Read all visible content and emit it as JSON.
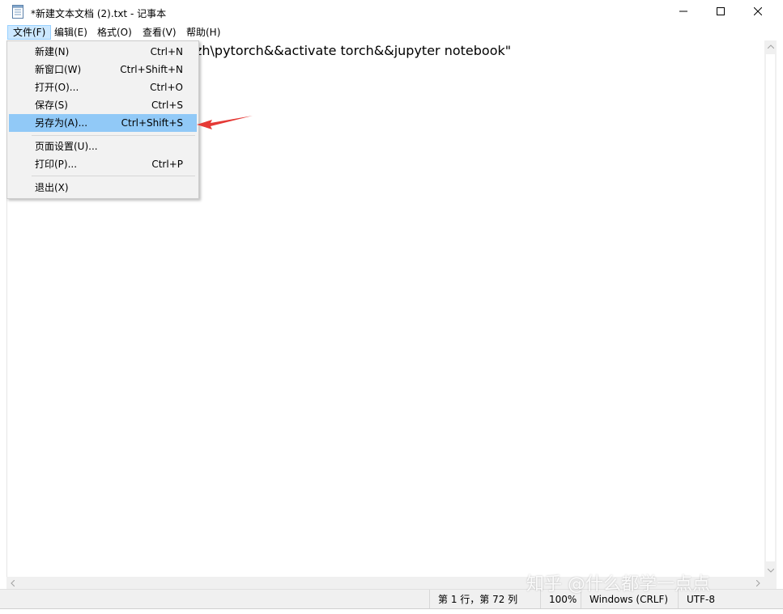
{
  "window": {
    "title": "*新建文本文档 (2).txt - 记事本"
  },
  "menubar": {
    "items": [
      "文件(F)",
      "编辑(E)",
      "格式(O)",
      "查看(V)",
      "帮助(H)"
    ]
  },
  "file_menu": {
    "items": [
      {
        "label": "新建(N)",
        "shortcut": "Ctrl+N"
      },
      {
        "label": "新窗口(W)",
        "shortcut": "Ctrl+Shift+N"
      },
      {
        "label": "打开(O)...",
        "shortcut": "Ctrl+O"
      },
      {
        "label": "保存(S)",
        "shortcut": "Ctrl+S"
      },
      {
        "label": "另存为(A)...",
        "shortcut": "Ctrl+Shift+S",
        "highlighted": true
      },
      {
        "label": "页面设置(U)...",
        "shortcut": ""
      },
      {
        "label": "打印(P)...",
        "shortcut": "Ctrl+P"
      },
      {
        "label": "退出(X)",
        "shortcut": ""
      }
    ]
  },
  "editor": {
    "text": "zh\\pytorch&&activate torch&&jupyter notebook\""
  },
  "statusbar": {
    "position": "第 1 行，第 72 列",
    "zoom": "100%",
    "line_ending": "Windows (CRLF)",
    "encoding": "UTF-8"
  },
  "watermark": {
    "text": "知乎 @什么都学一点点"
  },
  "colors": {
    "menu_highlight": "#91c9f7",
    "menu_active": "#cce8ff",
    "annotation_arrow": "#e53935"
  },
  "icons": [
    "notepad-icon",
    "minimize-icon",
    "maximize-icon",
    "close-icon",
    "scroll-up-icon",
    "scroll-down-icon",
    "scroll-left-icon",
    "scroll-right-icon"
  ]
}
